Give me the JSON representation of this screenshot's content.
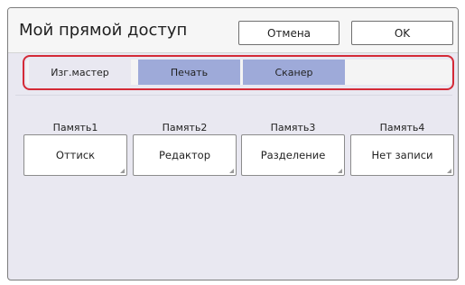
{
  "header": {
    "title": "Мой прямой доступ",
    "cancel_label": "Отмена",
    "ok_label": "OK"
  },
  "tabs": [
    {
      "label": "Изг.мастер",
      "active": true
    },
    {
      "label": "Печать",
      "active": false
    },
    {
      "label": "Сканер",
      "active": false
    }
  ],
  "memory": [
    {
      "label": "Память1",
      "value": "Оттиск"
    },
    {
      "label": "Память2",
      "value": "Редактор"
    },
    {
      "label": "Память3",
      "value": "Разделение"
    },
    {
      "label": "Память4",
      "value": "Нет записи"
    }
  ],
  "colors": {
    "tab_inactive": "#9eaad9",
    "panel_background": "#e9e8f1",
    "highlight_border": "#d42a37"
  }
}
